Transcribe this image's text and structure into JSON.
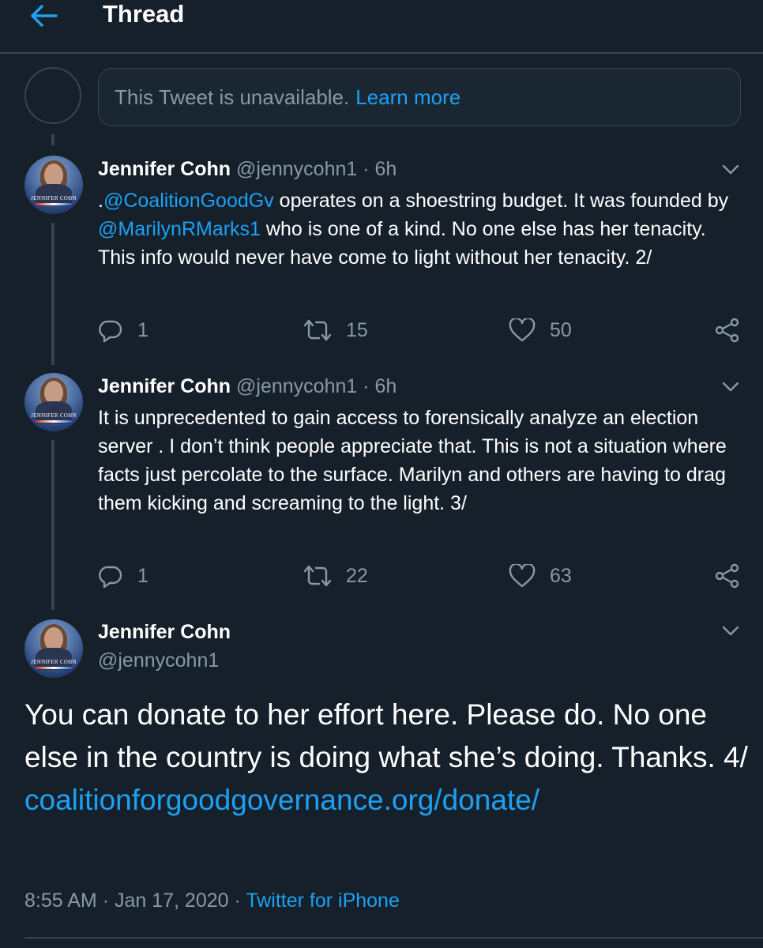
{
  "header": {
    "title": "Thread"
  },
  "unavailable": {
    "text": "This Tweet is unavailable.",
    "link": "Learn more"
  },
  "tweets": [
    {
      "name": "Jennifer Cohn",
      "handle": "@jennycohn1",
      "dot": "·",
      "time": "6h",
      "text_pre": ".",
      "mention1": "@CoalitionGoodGv",
      "text_mid": " operates on a shoestring budget. It was founded by ",
      "mention2": "@MarilynRMarks1",
      "text_post": " who is one of a kind. No one else has her tenacity. This info would never have come to light without her tenacity. 2/",
      "replies": "1",
      "retweets": "15",
      "likes": "50"
    },
    {
      "name": "Jennifer Cohn",
      "handle": "@jennycohn1",
      "dot": "·",
      "time": "6h",
      "text": "It is unprecedented to gain access to forensically analyze an election server . I don’t think people appreciate that. This is not a situation where facts just percolate to the surface. Marilyn and others are having to drag them kicking and screaming to the light. 3/",
      "replies": "1",
      "retweets": "22",
      "likes": "63"
    }
  ],
  "main": {
    "name": "Jennifer Cohn",
    "handle": "@jennycohn1",
    "text": "You can donate to her effort here. Please do. No one else in the country is doing what she’s doing. Thanks. 4/",
    "link": "coalitionforgoodgovernance.org/donate/",
    "time": "8:55 AM",
    "sep": "·",
    "date": "Jan 17, 2020",
    "sep2": "·",
    "source": "Twitter for iPhone"
  },
  "avatar_caption": "JENNIFER COHN",
  "colors": {
    "background": "#15202b",
    "accent": "#1da1f2",
    "secondary": "#8899a6",
    "border": "#38444d"
  }
}
